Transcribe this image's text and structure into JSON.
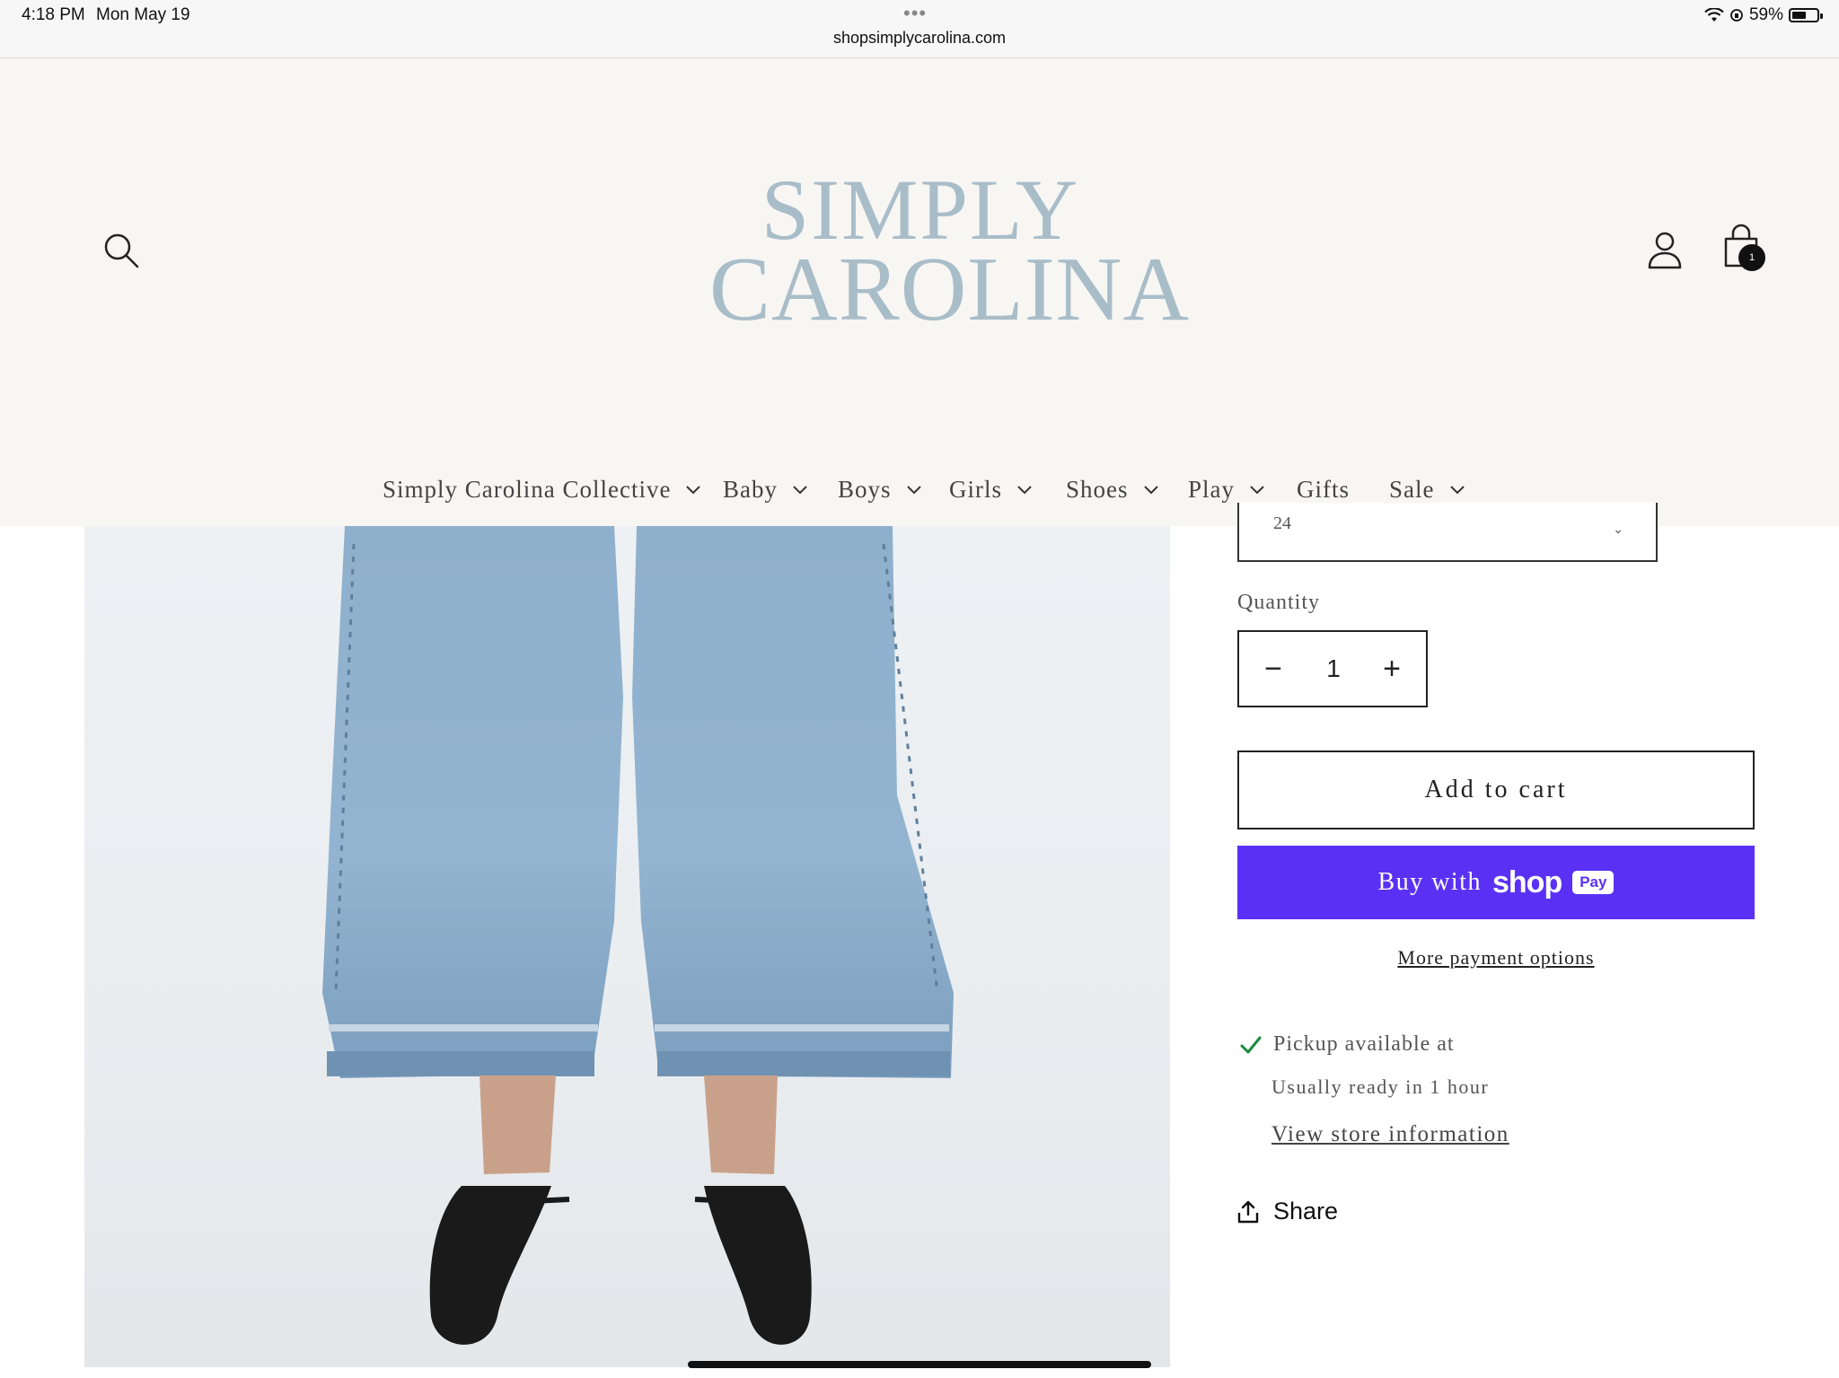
{
  "status_bar": {
    "time": "4:18 PM",
    "date": "Mon May 19",
    "url": "shopsimplycarolina.com",
    "battery": "59%",
    "battery_level": 0.59
  },
  "header": {
    "logo_line1": "SIMPLY",
    "logo_line2": "CAROLINA",
    "cart_count": "1",
    "logo_color": "#a9bdc9"
  },
  "nav": {
    "items": [
      {
        "label": "Simply Carolina Collective",
        "has_dropdown": true
      },
      {
        "label": "Baby",
        "has_dropdown": true
      },
      {
        "label": "Boys",
        "has_dropdown": true
      },
      {
        "label": "Girls",
        "has_dropdown": true
      },
      {
        "label": "Shoes",
        "has_dropdown": true
      },
      {
        "label": "Play",
        "has_dropdown": true
      },
      {
        "label": "Gifts",
        "has_dropdown": false
      },
      {
        "label": "Sale",
        "has_dropdown": true
      }
    ]
  },
  "product": {
    "variant_value": "24",
    "quantity_label": "Quantity",
    "quantity": "1",
    "add_to_cart": "Add to cart",
    "shop_pay_prefix": "Buy with",
    "shop_pay_brand": "shop",
    "shop_pay_badge": "Pay",
    "shop_pay_color": "#5a31f4",
    "more_payment": "More payment options",
    "pickup_available": "Pickup available at",
    "pickup_ready": "Usually ready in 1 hour",
    "store_info": "View store information",
    "share": "Share"
  }
}
